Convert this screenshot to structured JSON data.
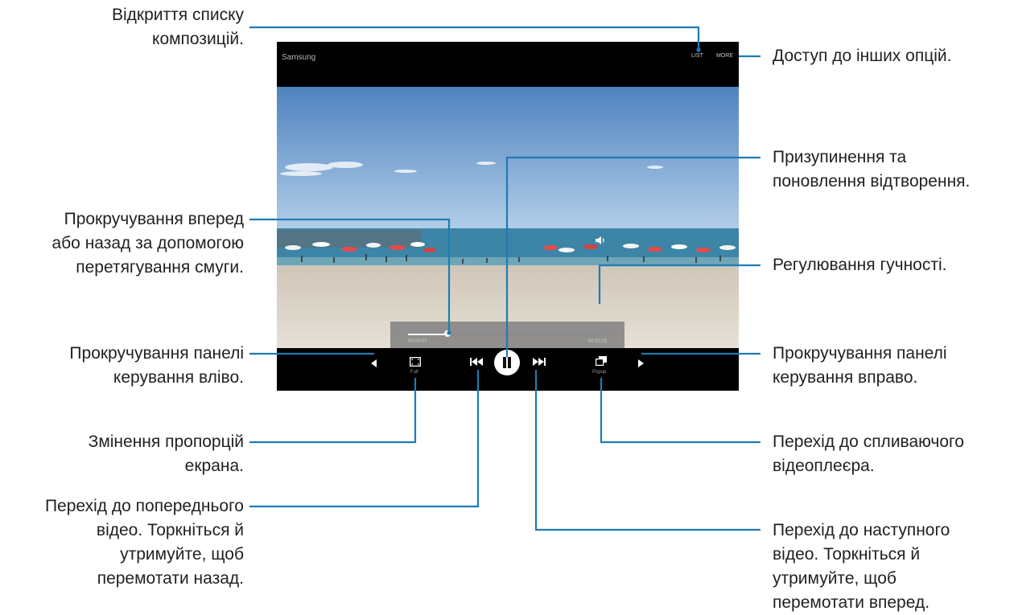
{
  "player": {
    "title": "Samsung",
    "list_label": "LIST",
    "more_label": "MORE",
    "time_elapsed": "00:00:07",
    "time_total": "00:00:23",
    "progress": 0.2,
    "ratio_label": "Full",
    "popup_label": "Popup",
    "icons": {
      "scroll_left": "triangle-left-icon",
      "ratio": "screen-ratio-icon",
      "prev": "skip-previous-icon",
      "pause": "pause-icon",
      "next": "skip-next-icon",
      "popup": "popup-player-icon",
      "scroll_right": "triangle-right-icon",
      "volume": "speaker-icon"
    }
  },
  "callouts": {
    "open_list": [
      "Відкриття списку",
      "композицій."
    ],
    "more_options": [
      "Доступ до інших опцій."
    ],
    "pause_resume": [
      "Призупинення та",
      "поновлення відтворення."
    ],
    "seek": [
      "Прокручування вперед",
      "або назад за допомогою",
      "перетягування смуги."
    ],
    "volume": [
      "Регулювання гучності."
    ],
    "scroll_left": [
      "Прокручування панелі",
      "керування вліво."
    ],
    "scroll_right": [
      "Прокручування панелі",
      "керування вправо."
    ],
    "aspect_ratio": [
      "Змінення пропорцій",
      "екрана."
    ],
    "popup_player": [
      "Перехід до спливаючого",
      "відеоплеєра."
    ],
    "previous_video": [
      "Перехід до попереднього",
      "відео. Торкніться й",
      "утримуйте, щоб",
      "перемотати назад."
    ],
    "next_video": [
      "Перехід до наступного",
      "відео. Торкніться й",
      "утримуйте, щоб",
      "перемотати вперед."
    ]
  },
  "colors": {
    "callout_line": "#1e7bb4",
    "text": "#231f20",
    "sky_top": "#5b8ac4",
    "sky_bottom": "#a9c8e6",
    "sea": "#3f86a8",
    "sand": "#d8d0c3"
  }
}
